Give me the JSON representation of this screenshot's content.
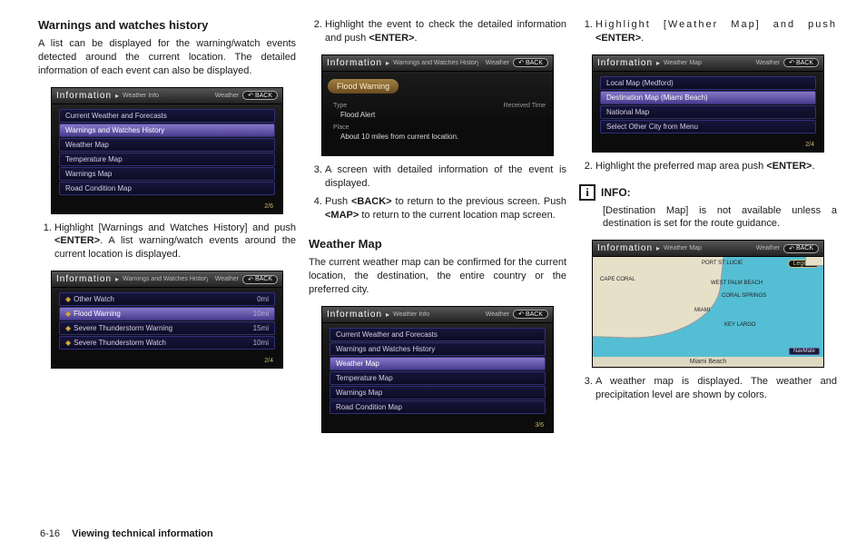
{
  "col1": {
    "h1": "Warnings and watches history",
    "p1": "A list can be displayed for the warning/watch events detected around the current location. The detailed information of each event can also be displayed.",
    "step1_a": "Highlight [Warnings and Watches History] and push ",
    "step1_key": "<ENTER>",
    "step1_b": ". A list warning/watch events around the current location is displayed.",
    "dev1": {
      "title": "Information",
      "crumb": "Weather Info",
      "weather": "Weather",
      "back": "BACK",
      "items": [
        "Current Weather and Forecasts",
        "Warnings and Watches History",
        "Weather Map",
        "Temperature Map",
        "Warnings Map",
        "Road Condition Map"
      ],
      "footer": "2/6"
    },
    "dev2": {
      "title": "Information",
      "crumb": "Warnings and Watches History",
      "weather": "Weather",
      "back": "BACK",
      "items": [
        {
          "label": "Other Watch",
          "dist": "0mi"
        },
        {
          "label": "Flood Warning",
          "dist": "10mi"
        },
        {
          "label": "Severe Thunderstorm Warning",
          "dist": "15mi"
        },
        {
          "label": "Severe Thunderstorm Watch",
          "dist": "10mi"
        }
      ],
      "footer": "2/4"
    }
  },
  "col2": {
    "step2_a": "Highlight the event to check the detailed information and push ",
    "step2_key": "<ENTER>",
    "step2_b": ".",
    "dev3": {
      "title": "Information",
      "crumb": "Warnings and Watches History",
      "weather": "Weather",
      "back": "BACK",
      "pill": "Flood Warning",
      "type_lbl": "Type",
      "recv_lbl": "Received Time",
      "type_val": "Flood Alert",
      "place_lbl": "Place",
      "place_val": "About 10 miles from current location."
    },
    "step3": "A screen with detailed information of the event is displayed.",
    "step4_a": "Push ",
    "step4_key1": "<BACK>",
    "step4_b": " to return to the previous screen. Push ",
    "step4_key2": "<MAP>",
    "step4_c": " to return to the current location map screen.",
    "h2": "Weather Map",
    "p2": "The current weather map can be confirmed for the current location, the destination, the entire country or the preferred city.",
    "dev4": {
      "title": "Information",
      "crumb": "Weather Info",
      "weather": "Weather",
      "back": "BACK",
      "items": [
        "Current Weather and Forecasts",
        "Warnings and Watches History",
        "Weather Map",
        "Temperature Map",
        "Warnings Map",
        "Road Condition Map"
      ],
      "footer": "3/6"
    }
  },
  "col3": {
    "step1_a": "Highlight [Weather Map] and push ",
    "step1_key": "<ENTER>",
    "step1_b": ".",
    "dev5": {
      "title": "Information",
      "crumb": "Weather Map",
      "weather": "Weather",
      "back": "BACK",
      "items": [
        "Local Map (Medford)",
        "Destination Map (Miami Beach)",
        "National Map",
        "Select Other City from Menu"
      ],
      "footer": "2/4"
    },
    "step2_a": "Highlight the preferred map area push ",
    "step2_key": "<ENTER>",
    "step2_b": ".",
    "info_lbl": "INFO:",
    "info_body": "[Destination Map] is not available unless a destination is set for the route guidance.",
    "dev6": {
      "title": "Information",
      "crumb": "Weather Map",
      "weather": "Weather",
      "back": "BACK",
      "legend": "Legend",
      "nm": "NavMate",
      "bottom": "Miami Beach",
      "labels": {
        "l1": "PORT ST LUCIE",
        "l2": "CAPE CORAL",
        "l3": "WEST PALM BEACH",
        "l4": "CORAL SPRINGS",
        "l5": "MIAMI",
        "l6": "KEY LARGO"
      }
    },
    "step3": "A weather map is displayed. The weather and precipitation level are shown by colors."
  },
  "footer": {
    "num": "6-16",
    "title": "Viewing technical information"
  }
}
